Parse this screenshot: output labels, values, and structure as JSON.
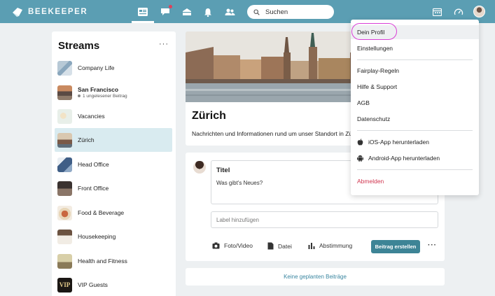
{
  "brand": {
    "name": "BEEKEEPER"
  },
  "topbar": {
    "search_placeholder": "Suchen",
    "nav_icons": [
      "streams-icon",
      "chat-icon",
      "home-icon",
      "notifications-icon",
      "people-icon"
    ],
    "right_icons": [
      "calendar-icon",
      "dashboard-icon"
    ]
  },
  "sidebar": {
    "title": "Streams",
    "more": "···",
    "items": [
      {
        "label": "Company Life"
      },
      {
        "label": "San Francisco",
        "sub": "1 ungelesener Beitrag",
        "bold": true
      },
      {
        "label": "Vacancies"
      },
      {
        "label": "Zürich",
        "active": true
      },
      {
        "label": "Head Office"
      },
      {
        "label": "Front Office"
      },
      {
        "label": "Food & Beverage"
      },
      {
        "label": "Housekeeping"
      },
      {
        "label": "Health and Fitness"
      },
      {
        "label": "VIP Guests",
        "thumb_text": "VIP"
      }
    ]
  },
  "stream_header": {
    "title": "Zürich",
    "description": "Nachrichten und Informationen rund um unser Standort in Züri"
  },
  "composer": {
    "title_label": "Titel",
    "body_placeholder": "Was gibt's Neues?",
    "label_placeholder": "Label hinzufügen",
    "actions": [
      "Foto/Video",
      "Datei",
      "Abstimmung"
    ],
    "submit_label": "Beitrag erstellen",
    "more": "···"
  },
  "scheduled": {
    "label": "Keine geplanten Beiträge"
  },
  "profile_menu": {
    "items": [
      "Dein Profil",
      "Einstellungen",
      "Fairplay-Regeln",
      "Hilfe & Support",
      "AGB",
      "Datenschutz",
      "iOS-App herunterladen",
      "Android-App herunterladen",
      "Abmelden"
    ]
  },
  "colors": {
    "topbar": "#5b9eb3",
    "accent": "#3d8496",
    "link": "#3a86a0",
    "danger": "#d0354f",
    "highlight": "#d93fd6"
  }
}
